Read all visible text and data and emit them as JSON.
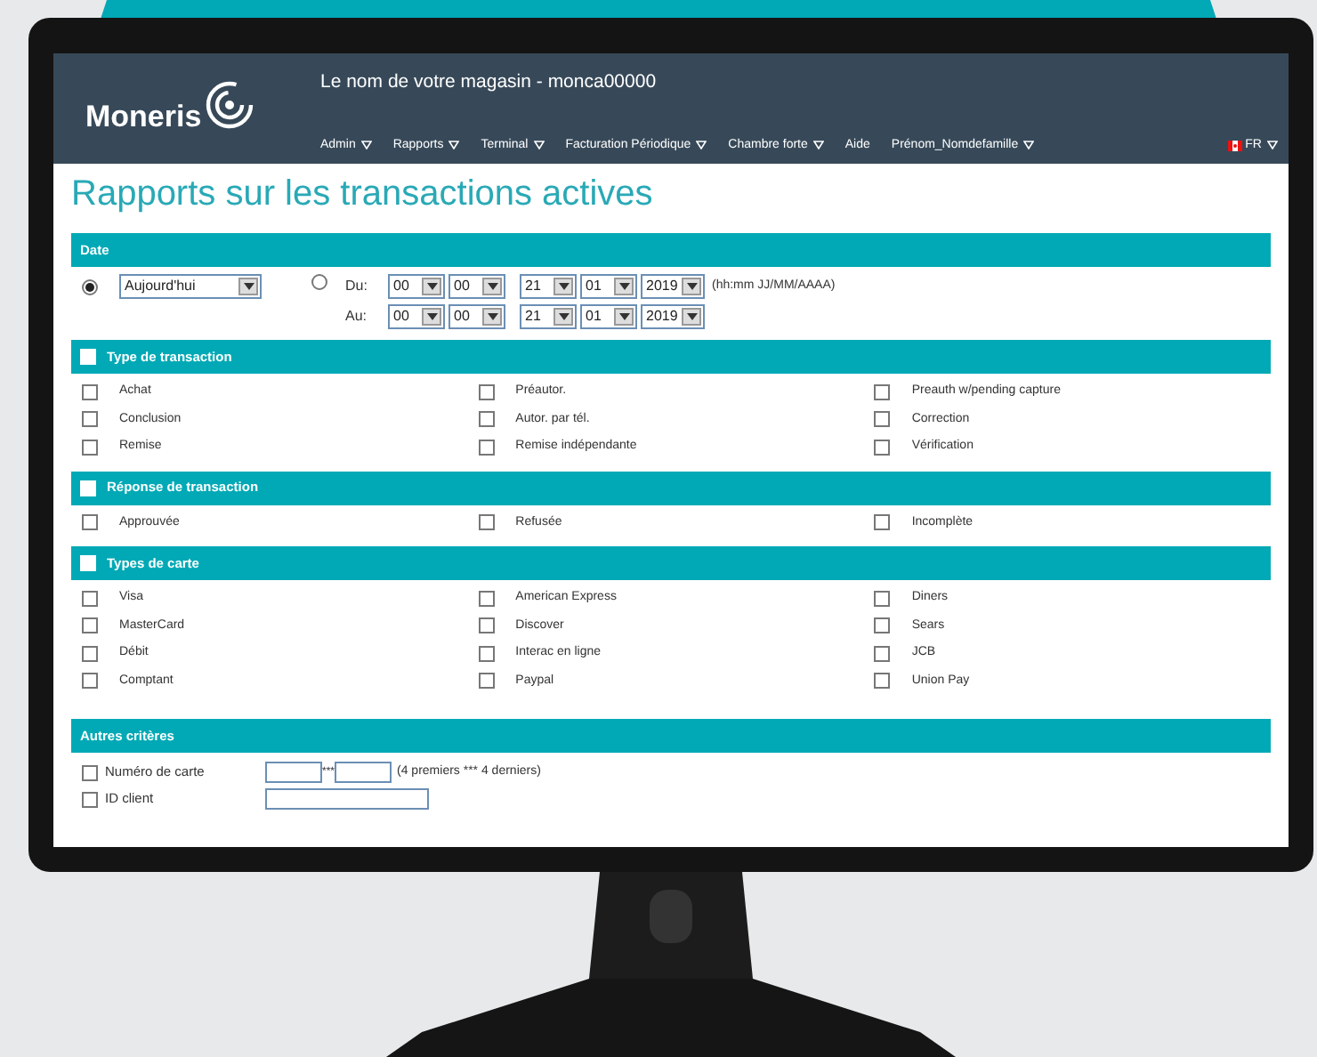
{
  "header": {
    "logo": "Moneris",
    "store": "Le nom de votre magasin - monca00000",
    "language": "FR",
    "menu": [
      {
        "label": "Admin",
        "dropdown": true
      },
      {
        "label": "Rapports",
        "dropdown": true
      },
      {
        "label": "Terminal",
        "dropdown": true
      },
      {
        "label": "Facturation Périodique",
        "dropdown": true
      },
      {
        "label": "Chambre forte",
        "dropdown": true
      },
      {
        "label": "Aide",
        "dropdown": false
      },
      {
        "label": "Prénom_Nomdefamille",
        "dropdown": true
      }
    ]
  },
  "title": "Rapports sur les transactions actives",
  "date_section": {
    "title": "Date",
    "preset": {
      "selected": true,
      "value": "Aujourd'hui"
    },
    "range": {
      "selected": false,
      "hint": "(hh:mm JJ/MM/AAAA)",
      "rows": [
        {
          "label": "Du:",
          "hour": "00",
          "minute": "00",
          "day": "21",
          "month": "01",
          "year": "2019"
        },
        {
          "label": "Au:",
          "hour": "00",
          "minute": "00",
          "day": "21",
          "month": "01",
          "year": "2019"
        }
      ]
    }
  },
  "sections": [
    {
      "title": "Type de transaction",
      "checked": false,
      "items": [
        {
          "label": "Achat",
          "checked": false
        },
        {
          "label": "Préautor.",
          "checked": false
        },
        {
          "label": "Preauth w/pending capture",
          "checked": false
        },
        {
          "label": "Conclusion",
          "checked": false
        },
        {
          "label": "Autor. par tél.",
          "checked": false
        },
        {
          "label": "Correction",
          "checked": false
        },
        {
          "label": "Remise",
          "checked": false
        },
        {
          "label": "Remise indépendante",
          "checked": false
        },
        {
          "label": "Vérification",
          "checked": false
        }
      ]
    },
    {
      "title": "Réponse de transaction",
      "checked": false,
      "items": [
        {
          "label": "Approuvée",
          "checked": false
        },
        {
          "label": "Refusée",
          "checked": false
        },
        {
          "label": "Incomplète",
          "checked": false
        }
      ]
    },
    {
      "title": "Types de carte",
      "checked": false,
      "items": [
        {
          "label": "Visa",
          "checked": false
        },
        {
          "label": "American Express",
          "checked": false
        },
        {
          "label": "Diners",
          "checked": false
        },
        {
          "label": "MasterCard",
          "checked": false
        },
        {
          "label": "Discover",
          "checked": false
        },
        {
          "label": "Sears",
          "checked": false
        },
        {
          "label": "Débit",
          "checked": false
        },
        {
          "label": "Interac en ligne",
          "checked": false
        },
        {
          "label": "JCB",
          "checked": false
        },
        {
          "label": "Comptant",
          "checked": false
        },
        {
          "label": "Paypal",
          "checked": false
        },
        {
          "label": "Union Pay",
          "checked": false
        }
      ]
    }
  ],
  "other_criteria": {
    "title": "Autres critères",
    "rows": [
      {
        "kind": "split",
        "label": "Numéro de carte",
        "checked": false,
        "separator": "***",
        "hint": "(4 premiers *** 4 derniers)"
      },
      {
        "kind": "single",
        "label": "ID client",
        "checked": false
      }
    ]
  }
}
